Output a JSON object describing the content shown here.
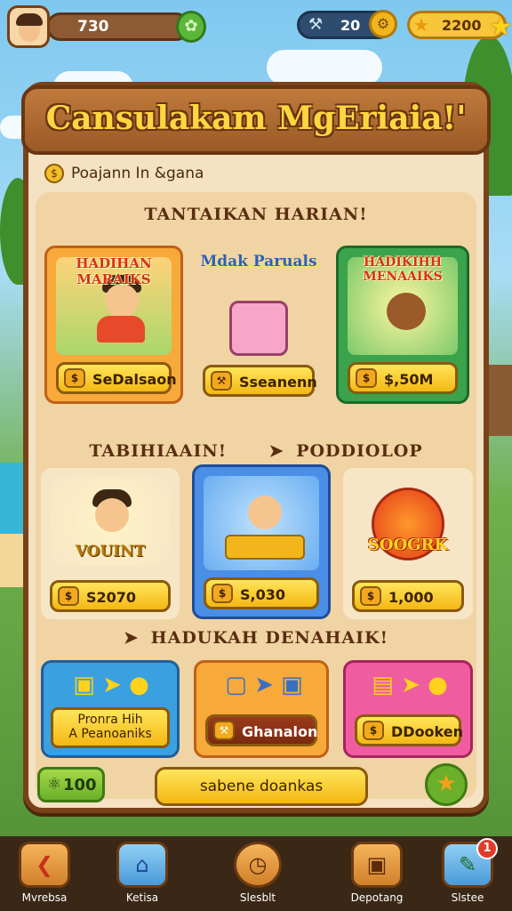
{
  "hud": {
    "xp_value": "730",
    "currency_blue": "20",
    "currency_gold": "2200"
  },
  "panel": {
    "title": "Cansulakam MgEriaia!'",
    "subtitle": "Poajann In &gana"
  },
  "section1": {
    "title": "TANTAIKAN HARIAN!",
    "cards": [
      {
        "label": "HADIHAN MARAIKS",
        "value": "SeDalsaon"
      },
      {
        "label": "Mdak Paruals",
        "value": "Sseanenn"
      },
      {
        "label": "HADIKIHH MENAAIKS",
        "value": "$,50M"
      }
    ]
  },
  "section2": {
    "title_left": "TABIHIAAIN!",
    "title_right": "PODDIOLOP",
    "cards": [
      {
        "label": "VOUINT",
        "value": "S2070"
      },
      {
        "label": "",
        "value": "S,030"
      },
      {
        "label": "SOOGRK",
        "value": "1,000"
      }
    ]
  },
  "section3": {
    "title": "HADUKAH DENAHAIK!",
    "cards": [
      {
        "value_line1": "Pronra Hih",
        "value_line2": "A Peanoaniks"
      },
      {
        "value": "Ghanalon"
      },
      {
        "value": "DDooken"
      }
    ]
  },
  "footer": {
    "count": "100",
    "main_button": "sabene doankas"
  },
  "nav": [
    {
      "label": "Mvrebsa"
    },
    {
      "label": "Ketisa"
    },
    {
      "label": "Slesblt"
    },
    {
      "label": "Depotang"
    },
    {
      "label": "Slstee",
      "badge": "1"
    }
  ]
}
